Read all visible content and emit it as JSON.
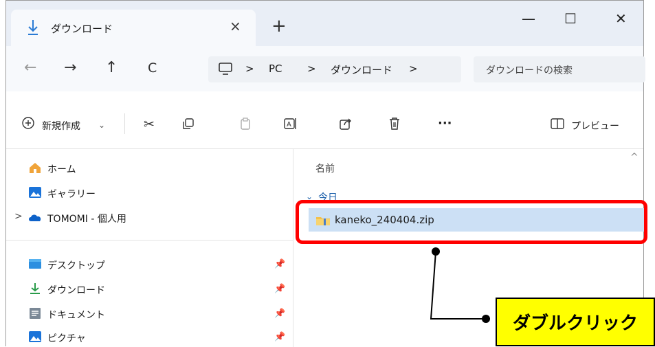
{
  "window": {
    "tab_title": "ダウンロード",
    "tab_close": "×",
    "new_tab": "+",
    "minimize": "—",
    "maximize": "☐",
    "close": "✕"
  },
  "nav": {
    "back": "←",
    "forward": "→",
    "up": "↑",
    "refresh": "C",
    "breadcrumb": [
      ">",
      "PC",
      ">",
      "ダウンロード",
      ">"
    ],
    "search_placeholder": "ダウンロードの検索"
  },
  "toolbar": {
    "new_label": "新規作成",
    "new_chevron": "⌄",
    "more": "···",
    "preview_label": "プレビュー"
  },
  "sidebar": {
    "items": [
      {
        "label": "ホーム",
        "icon": "home-icon"
      },
      {
        "label": "ギャラリー",
        "icon": "gallery-icon"
      },
      {
        "label": "TOMOMI - 個人用",
        "icon": "onedrive-icon",
        "chevron": ">"
      }
    ],
    "quick_access": [
      {
        "label": "デスクトップ",
        "icon": "desktop-icon"
      },
      {
        "label": "ダウンロード",
        "icon": "download-icon"
      },
      {
        "label": "ドキュメント",
        "icon": "documents-icon"
      },
      {
        "label": "ピクチャ",
        "icon": "pictures-icon"
      }
    ]
  },
  "main": {
    "column_name": "名前",
    "group_label": "今日",
    "group_chevron": "⌄",
    "scroll_up": "^",
    "files": [
      {
        "name": "kaneko_240404.zip",
        "icon": "zip-folder-icon"
      }
    ]
  },
  "annotation": {
    "callout_text": "ダブルクリック",
    "highlight_color": "#ff0000",
    "callout_color": "#ffff00"
  }
}
